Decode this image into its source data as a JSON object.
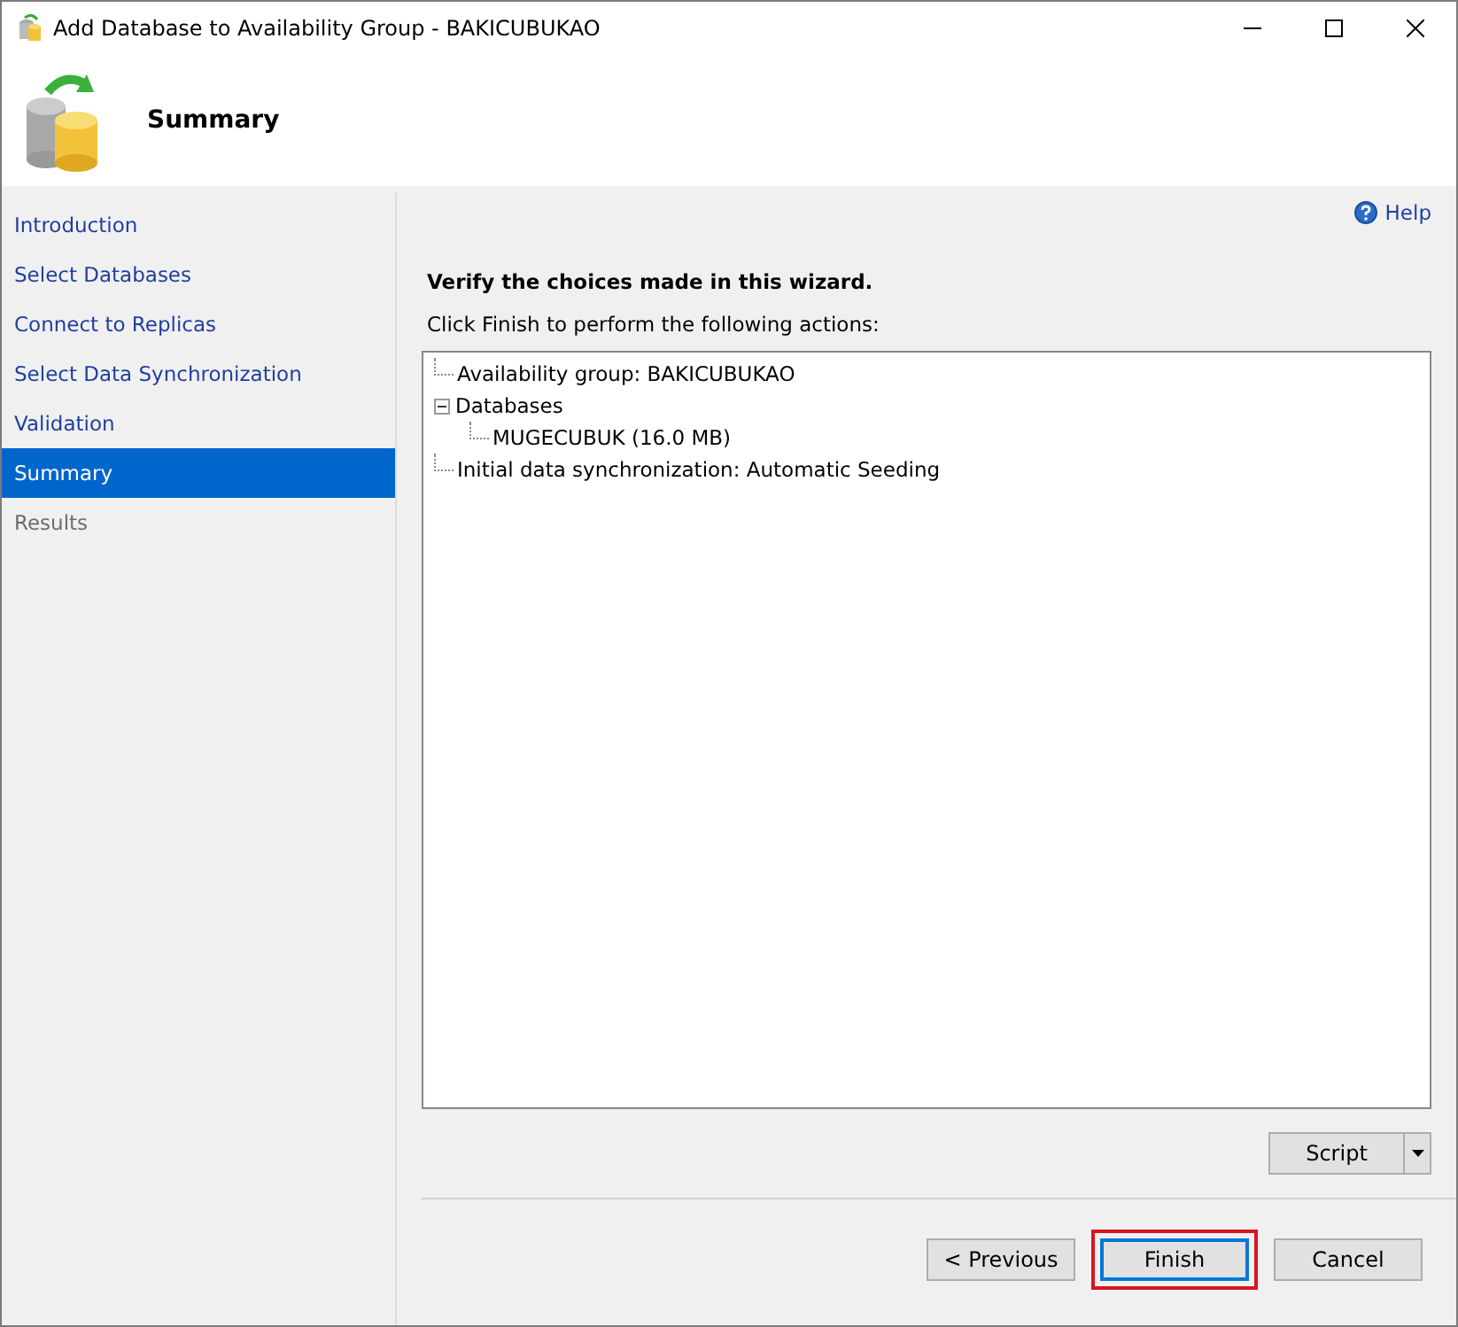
{
  "window": {
    "title": "Add Database to Availability Group - BAKICUBUKAO"
  },
  "header": {
    "title": "Summary"
  },
  "sidebar": {
    "items": [
      {
        "label": "Introduction",
        "selected": false,
        "disabled": false
      },
      {
        "label": "Select Databases",
        "selected": false,
        "disabled": false
      },
      {
        "label": "Connect to Replicas",
        "selected": false,
        "disabled": false
      },
      {
        "label": "Select Data Synchronization",
        "selected": false,
        "disabled": false
      },
      {
        "label": "Validation",
        "selected": false,
        "disabled": false
      },
      {
        "label": "Summary",
        "selected": true,
        "disabled": false
      },
      {
        "label": "Results",
        "selected": false,
        "disabled": true
      }
    ]
  },
  "help": {
    "label": "Help"
  },
  "heading": "Verify the choices made in this wizard.",
  "instruction": "Click Finish to perform the following actions:",
  "tree": [
    {
      "label": "Availability group: BAKICUBUKAO"
    },
    {
      "label": "Databases",
      "expanded": true,
      "children": [
        {
          "label": "MUGECUBUK (16.0 MB)"
        }
      ]
    },
    {
      "label": "Initial data synchronization: Automatic Seeding"
    }
  ],
  "script_button": {
    "label": "Script"
  },
  "buttons": [
    {
      "label": "< Previous",
      "default": false,
      "highlighted": false
    },
    {
      "label": "Finish",
      "default": true,
      "highlighted": true
    },
    {
      "label": "Cancel",
      "default": false,
      "highlighted": false
    }
  ]
}
